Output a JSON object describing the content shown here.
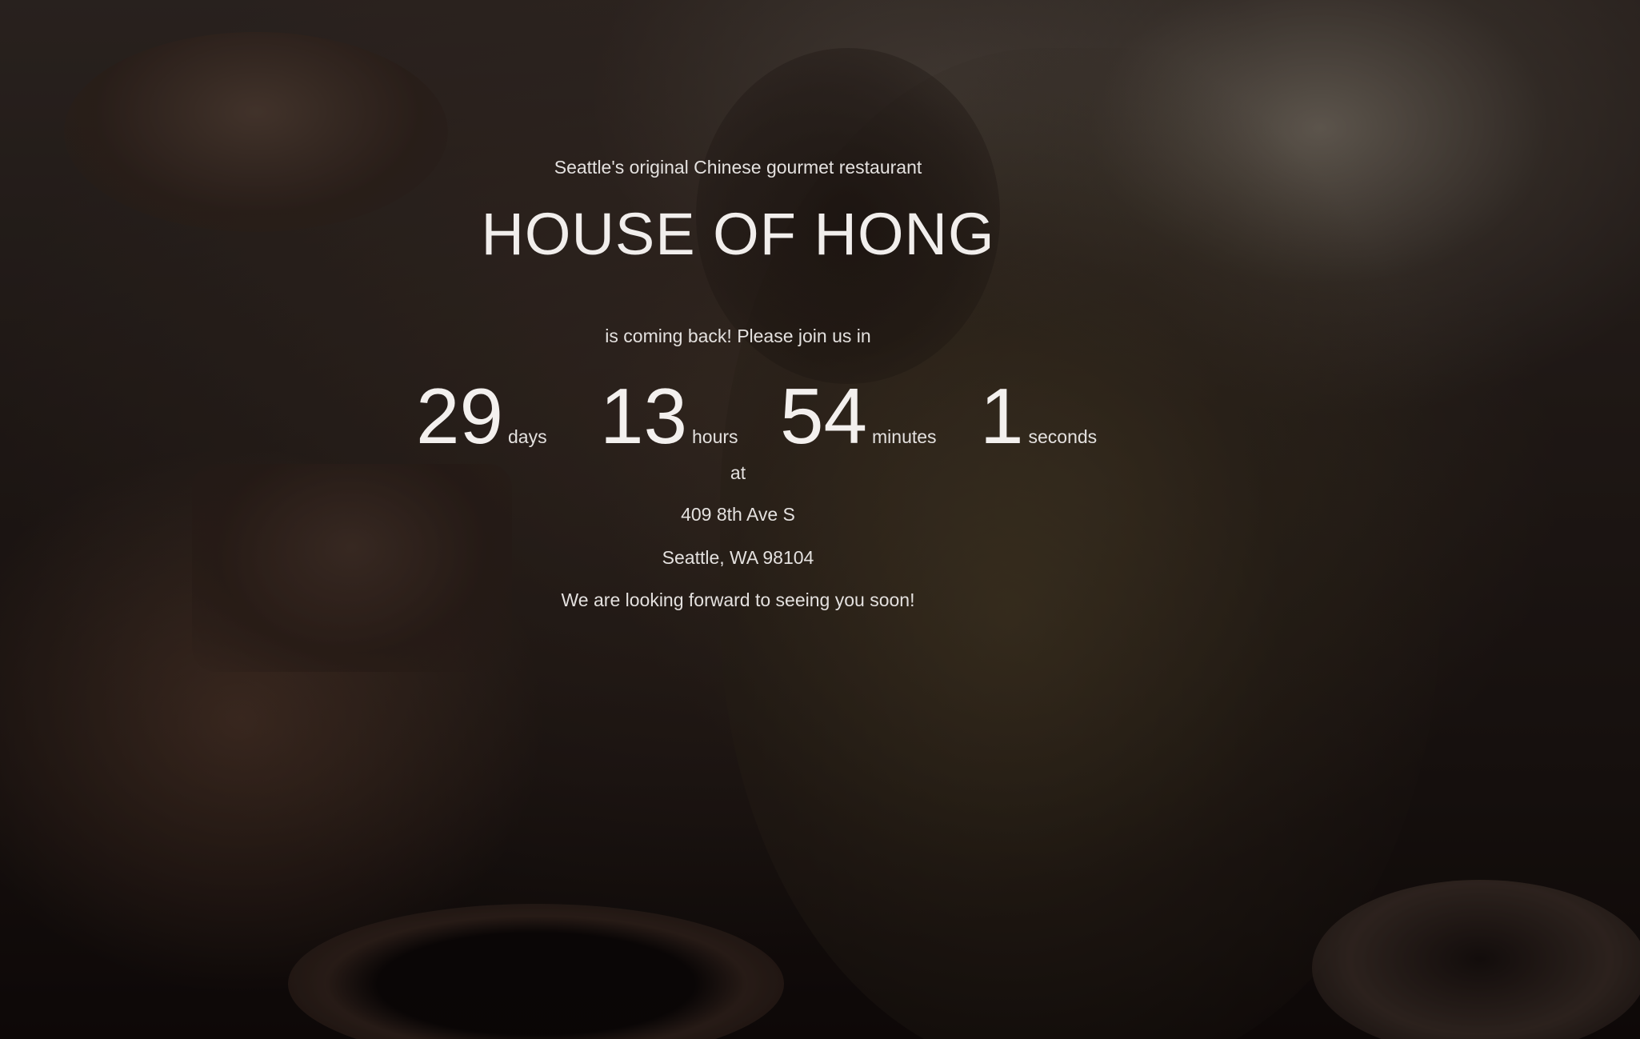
{
  "hero": {
    "tagline": "Seattle's original Chinese gourmet restaurant",
    "title": "HOUSE OF HONG",
    "intro": "is coming back! Please join us in"
  },
  "countdown": {
    "days": {
      "value": "29",
      "label": "days"
    },
    "hours": {
      "value": "13",
      "label": "hours"
    },
    "minutes": {
      "value": "54",
      "label": "minutes"
    },
    "seconds": {
      "value": "1",
      "label": "seconds"
    }
  },
  "location": {
    "at_label": "at",
    "street": "409 8th Ave S",
    "city": "Seattle, WA 98104"
  },
  "closing": "We are looking forward to seeing you soon!"
}
